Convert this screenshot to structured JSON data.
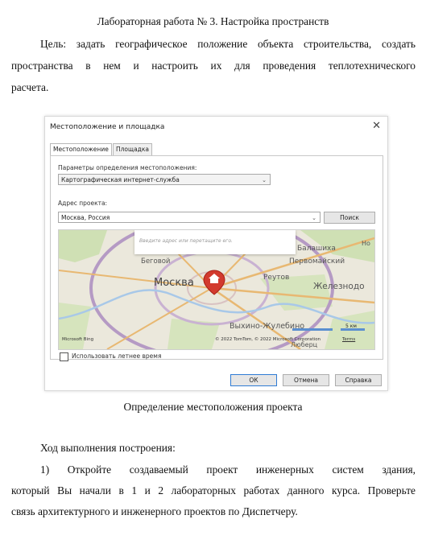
{
  "doc": {
    "title": "Лабораторная работа № 3. Настройка пространств",
    "goal_line1": "Цель: задать географическое положение объекта строительства, создать",
    "goal_line2": "пространства в нем и настроить их для проведения теплотехнического",
    "goal_line3": "расчета.",
    "caption": "Определение местоположения проекта",
    "progress_heading": "Ход выполнения построения:",
    "step1_line1": "1)  Откройте создаваемый проект инженерных систем здания,",
    "step1_line2": "который Вы начали в 1 и 2 лабораторных работах данного курса. Проверьте",
    "step1_line3": "связь архитектурного и инженерного проектов по Диспетчеру."
  },
  "dialog": {
    "title": "Местоположение и площадка",
    "close": "✕",
    "tabs": [
      "Местоположение",
      "Площадка"
    ],
    "params_label": "Параметры определения местоположения:",
    "method_value": "Картографическая интернет-служба",
    "address_label": "Адрес проекта:",
    "address_value": "Москва, Россия",
    "search_button": "Поиск",
    "dst_label": "Использовать летнее время",
    "ok_button": "ОК",
    "cancel_button": "Отмена",
    "help_button": "Справка"
  },
  "map": {
    "tooltip_placeholder": "Введите адрес или перетащите его.",
    "labels": {
      "moscow": "Москва",
      "begovoy": "Беговой",
      "balashikha": "Балашиха",
      "pervomaysky": "Первомайский",
      "reutov": "Реутов",
      "zheleznodor": "Железнодо",
      "vykhino": "Выхино-Жулебино",
      "lyubertsy": "Люберц",
      "no": "Но"
    },
    "copyright": "© 2022 TomTom, © 2022 Microsoft Corporation",
    "terms": "Terms",
    "bing": "Microsoft Bing",
    "scale": "5 км",
    "marker": "location-pin"
  }
}
